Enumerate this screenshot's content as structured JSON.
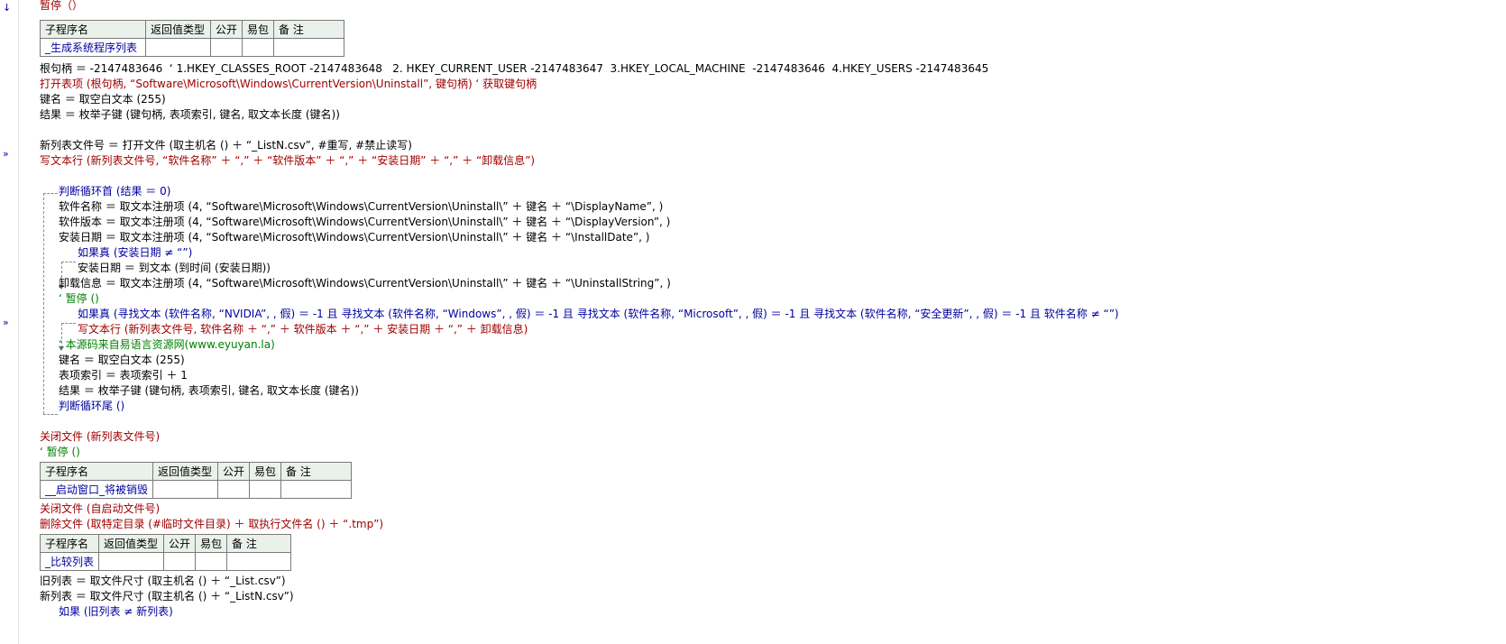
{
  "gutter": {
    "top_arrow": "↓",
    "exec_marker": "»"
  },
  "top_line": "暂停（）",
  "table1": {
    "headers": [
      "子程序名",
      "返回值类型",
      "公开",
      "易包",
      "备 注"
    ],
    "row": [
      "_生成系统程序列表",
      "",
      "",
      "",
      ""
    ]
  },
  "code1": [
    "根句柄 ＝ -2147483646  ‘ 1.HKEY_CLASSES_ROOT -2147483648   2. HKEY_CURRENT_USER -2147483647  3.HKEY_LOCAL_MACHINE  -2147483646  4.HKEY_USERS -2147483645",
    "打开表项 (根句柄, “Software\\Microsoft\\Windows\\CurrentVersion\\Uninstall”, 键句柄) ‘ 获取键句柄",
    "键名 ＝ 取空白文本 (255)",
    "结果 ＝ 枚举子键 (键句柄, 表项索引, 键名, 取文本长度 (键名))",
    "新列表文件号 ＝ 打开文件 (取主机名 () ＋ “_ListN.csv”, #重写, #禁止读写)",
    "写文本行 (新列表文件号, “软件名称” ＋ “,” ＋ “软件版本” ＋ “,” ＋ “安装日期” ＋ “,” ＋ “卸载信息”)"
  ],
  "loop": [
    "判断循环首 (结果 ＝ 0)",
    "软件名称 ＝ 取文本注册项 (4, “Software\\Microsoft\\Windows\\CurrentVersion\\Uninstall\\” ＋ 键名 ＋ “\\DisplayName”, )",
    "软件版本 ＝ 取文本注册项 (4, “Software\\Microsoft\\Windows\\CurrentVersion\\Uninstall\\” ＋ 键名 ＋ “\\DisplayVersion”, )",
    "安装日期 ＝ 取文本注册项 (4, “Software\\Microsoft\\Windows\\CurrentVersion\\Uninstall\\” ＋ 键名 ＋ “\\InstallDate”, )",
    "如果真 (安装日期 ≠ “”)",
    "安装日期 ＝ 到文本 (到时间 (安装日期))",
    "卸载信息 ＝ 取文本注册项 (4, “Software\\Microsoft\\Windows\\CurrentVersion\\Uninstall\\” ＋ 键名 ＋ “\\UninstallString”, )",
    "‘ 暂停 ()",
    "如果真 (寻找文本 (软件名称, “NVIDIA”, , 假) ＝ -1 且 寻找文本 (软件名称, “Windows”, , 假) ＝ -1 且 寻找文本 (软件名称, “Microsoft”, , 假) ＝ -1 且 寻找文本 (软件名称, “安全更新”, , 假) ＝ -1 且 软件名称 ≠ “”)",
    "写文本行 (新列表文件号, 软件名称 ＋ “,” ＋ 软件版本 ＋ “,” ＋ 安装日期 ＋ “,” ＋ 卸载信息)",
    "‘ 本源码来自易语言资源网(www.eyuyan.la)",
    "键名 ＝ 取空白文本 (255)",
    "表项索引 ＝ 表项索引 ＋ 1",
    "结果 ＝ 枚举子键 (键句柄, 表项索引, 键名, 取文本长度 (键名))",
    "判断循环尾 ()"
  ],
  "code2": [
    "关闭文件 (新列表文件号)",
    "‘ 暂停 ()"
  ],
  "table2": {
    "headers": [
      "子程序名",
      "返回值类型",
      "公开",
      "易包",
      "备 注"
    ],
    "row": [
      "__启动窗口_将被销毁",
      "",
      "",
      "",
      ""
    ]
  },
  "code3": [
    "关闭文件 (自启动文件号)",
    "删除文件 (取特定目录 (#临时文件目录) ＋ 取执行文件名 () ＋ “.tmp”)"
  ],
  "table3": {
    "headers": [
      "子程序名",
      "返回值类型",
      "公开",
      "易包",
      "备 注"
    ],
    "row": [
      "_比较列表",
      "",
      "",
      "",
      ""
    ]
  },
  "code4": [
    "旧列表 ＝ 取文件尺寸 (取主机名 () ＋ “_List.csv”)",
    "新列表 ＝ 取文件尺寸 (取主机名 () ＋ “_ListN.csv”)",
    "如果 (旧列表 ≠ 新列表)"
  ]
}
